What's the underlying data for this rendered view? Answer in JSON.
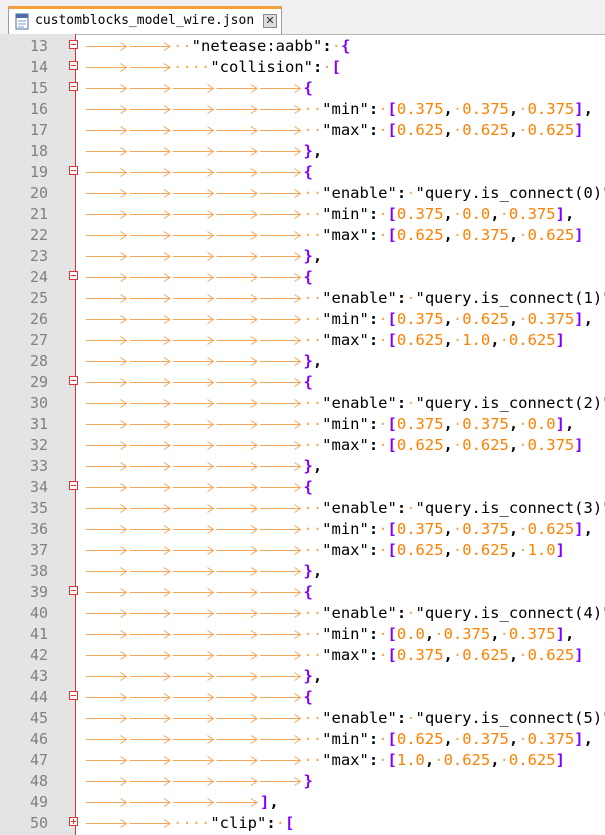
{
  "tab": {
    "title": "customblocks_model_wire.json"
  },
  "lines": [
    {
      "n": "13",
      "tabs": 2,
      "dots": 2,
      "fold": "minus",
      "tokens": [
        [
          "s",
          "\"netease:aabb\""
        ],
        [
          "o",
          ":"
        ],
        [
          "d",
          "·"
        ],
        [
          "p",
          "{"
        ]
      ]
    },
    {
      "n": "14",
      "tabs": 2,
      "dots": 4,
      "fold": "minus",
      "tokens": [
        [
          "s",
          "\"collision\""
        ],
        [
          "o",
          ":"
        ],
        [
          "d",
          "·"
        ],
        [
          "p",
          "["
        ]
      ]
    },
    {
      "n": "15",
      "tabs": 5,
      "dots": 0,
      "fold": "minus",
      "tokens": [
        [
          "p",
          "{"
        ]
      ]
    },
    {
      "n": "16",
      "tabs": 5,
      "dots": 2,
      "fold": "",
      "tokens": [
        [
          "s",
          "\"min\""
        ],
        [
          "o",
          ":"
        ],
        [
          "d",
          "·"
        ],
        [
          "p",
          "["
        ],
        [
          "n",
          "0.375"
        ],
        [
          "o",
          ","
        ],
        [
          "d",
          "·"
        ],
        [
          "n",
          "0.375"
        ],
        [
          "o",
          ","
        ],
        [
          "d",
          "·"
        ],
        [
          "n",
          "0.375"
        ],
        [
          "p",
          "]"
        ],
        [
          "o",
          ","
        ]
      ]
    },
    {
      "n": "17",
      "tabs": 5,
      "dots": 2,
      "fold": "",
      "tokens": [
        [
          "s",
          "\"max\""
        ],
        [
          "o",
          ":"
        ],
        [
          "d",
          "·"
        ],
        [
          "p",
          "["
        ],
        [
          "n",
          "0.625"
        ],
        [
          "o",
          ","
        ],
        [
          "d",
          "·"
        ],
        [
          "n",
          "0.625"
        ],
        [
          "o",
          ","
        ],
        [
          "d",
          "·"
        ],
        [
          "n",
          "0.625"
        ],
        [
          "p",
          "]"
        ]
      ]
    },
    {
      "n": "18",
      "tabs": 5,
      "dots": 0,
      "fold": "",
      "tokens": [
        [
          "p",
          "}"
        ],
        [
          "o",
          ","
        ]
      ]
    },
    {
      "n": "19",
      "tabs": 5,
      "dots": 0,
      "fold": "minus",
      "tokens": [
        [
          "p",
          "{"
        ]
      ]
    },
    {
      "n": "20",
      "tabs": 5,
      "dots": 2,
      "fold": "",
      "tokens": [
        [
          "s",
          "\"enable\""
        ],
        [
          "o",
          ":"
        ],
        [
          "d",
          "·"
        ],
        [
          "s",
          "\"query.is_connect(0)\""
        ],
        [
          "o",
          ","
        ]
      ]
    },
    {
      "n": "21",
      "tabs": 5,
      "dots": 2,
      "fold": "",
      "tokens": [
        [
          "s",
          "\"min\""
        ],
        [
          "o",
          ":"
        ],
        [
          "d",
          "·"
        ],
        [
          "p",
          "["
        ],
        [
          "n",
          "0.375"
        ],
        [
          "o",
          ","
        ],
        [
          "d",
          "·"
        ],
        [
          "n",
          "0.0"
        ],
        [
          "o",
          ","
        ],
        [
          "d",
          "·"
        ],
        [
          "n",
          "0.375"
        ],
        [
          "p",
          "]"
        ],
        [
          "o",
          ","
        ]
      ]
    },
    {
      "n": "22",
      "tabs": 5,
      "dots": 2,
      "fold": "",
      "tokens": [
        [
          "s",
          "\"max\""
        ],
        [
          "o",
          ":"
        ],
        [
          "d",
          "·"
        ],
        [
          "p",
          "["
        ],
        [
          "n",
          "0.625"
        ],
        [
          "o",
          ","
        ],
        [
          "d",
          "·"
        ],
        [
          "n",
          "0.375"
        ],
        [
          "o",
          ","
        ],
        [
          "d",
          "·"
        ],
        [
          "n",
          "0.625"
        ],
        [
          "p",
          "]"
        ]
      ]
    },
    {
      "n": "23",
      "tabs": 5,
      "dots": 0,
      "fold": "",
      "tokens": [
        [
          "p",
          "}"
        ],
        [
          "o",
          ","
        ]
      ]
    },
    {
      "n": "24",
      "tabs": 5,
      "dots": 0,
      "fold": "minus",
      "tokens": [
        [
          "p",
          "{"
        ]
      ]
    },
    {
      "n": "25",
      "tabs": 5,
      "dots": 2,
      "fold": "",
      "tokens": [
        [
          "s",
          "\"enable\""
        ],
        [
          "o",
          ":"
        ],
        [
          "d",
          "·"
        ],
        [
          "s",
          "\"query.is_connect(1)\""
        ],
        [
          "o",
          ","
        ]
      ]
    },
    {
      "n": "26",
      "tabs": 5,
      "dots": 2,
      "fold": "",
      "tokens": [
        [
          "s",
          "\"min\""
        ],
        [
          "o",
          ":"
        ],
        [
          "d",
          "·"
        ],
        [
          "p",
          "["
        ],
        [
          "n",
          "0.375"
        ],
        [
          "o",
          ","
        ],
        [
          "d",
          "·"
        ],
        [
          "n",
          "0.625"
        ],
        [
          "o",
          ","
        ],
        [
          "d",
          "·"
        ],
        [
          "n",
          "0.375"
        ],
        [
          "p",
          "]"
        ],
        [
          "o",
          ","
        ]
      ]
    },
    {
      "n": "27",
      "tabs": 5,
      "dots": 2,
      "fold": "",
      "tokens": [
        [
          "s",
          "\"max\""
        ],
        [
          "o",
          ":"
        ],
        [
          "d",
          "·"
        ],
        [
          "p",
          "["
        ],
        [
          "n",
          "0.625"
        ],
        [
          "o",
          ","
        ],
        [
          "d",
          "·"
        ],
        [
          "n",
          "1.0"
        ],
        [
          "o",
          ","
        ],
        [
          "d",
          "·"
        ],
        [
          "n",
          "0.625"
        ],
        [
          "p",
          "]"
        ]
      ]
    },
    {
      "n": "28",
      "tabs": 5,
      "dots": 0,
      "fold": "",
      "tokens": [
        [
          "p",
          "}"
        ],
        [
          "o",
          ","
        ]
      ]
    },
    {
      "n": "29",
      "tabs": 5,
      "dots": 0,
      "fold": "minus",
      "tokens": [
        [
          "p",
          "{"
        ]
      ]
    },
    {
      "n": "30",
      "tabs": 5,
      "dots": 2,
      "fold": "",
      "tokens": [
        [
          "s",
          "\"enable\""
        ],
        [
          "o",
          ":"
        ],
        [
          "d",
          "·"
        ],
        [
          "s",
          "\"query.is_connect(2)\""
        ],
        [
          "o",
          ","
        ]
      ]
    },
    {
      "n": "31",
      "tabs": 5,
      "dots": 2,
      "fold": "",
      "tokens": [
        [
          "s",
          "\"min\""
        ],
        [
          "o",
          ":"
        ],
        [
          "d",
          "·"
        ],
        [
          "p",
          "["
        ],
        [
          "n",
          "0.375"
        ],
        [
          "o",
          ","
        ],
        [
          "d",
          "·"
        ],
        [
          "n",
          "0.375"
        ],
        [
          "o",
          ","
        ],
        [
          "d",
          "·"
        ],
        [
          "n",
          "0.0"
        ],
        [
          "p",
          "]"
        ],
        [
          "o",
          ","
        ]
      ]
    },
    {
      "n": "32",
      "tabs": 5,
      "dots": 2,
      "fold": "",
      "tokens": [
        [
          "s",
          "\"max\""
        ],
        [
          "o",
          ":"
        ],
        [
          "d",
          "·"
        ],
        [
          "p",
          "["
        ],
        [
          "n",
          "0.625"
        ],
        [
          "o",
          ","
        ],
        [
          "d",
          "·"
        ],
        [
          "n",
          "0.625"
        ],
        [
          "o",
          ","
        ],
        [
          "d",
          "·"
        ],
        [
          "n",
          "0.375"
        ],
        [
          "p",
          "]"
        ]
      ]
    },
    {
      "n": "33",
      "tabs": 5,
      "dots": 0,
      "fold": "",
      "tokens": [
        [
          "p",
          "}"
        ],
        [
          "o",
          ","
        ]
      ]
    },
    {
      "n": "34",
      "tabs": 5,
      "dots": 0,
      "fold": "minus",
      "tokens": [
        [
          "p",
          "{"
        ]
      ]
    },
    {
      "n": "35",
      "tabs": 5,
      "dots": 2,
      "fold": "",
      "tokens": [
        [
          "s",
          "\"enable\""
        ],
        [
          "o",
          ":"
        ],
        [
          "d",
          "·"
        ],
        [
          "s",
          "\"query.is_connect(3)\""
        ],
        [
          "o",
          ","
        ]
      ]
    },
    {
      "n": "36",
      "tabs": 5,
      "dots": 2,
      "fold": "",
      "tokens": [
        [
          "s",
          "\"min\""
        ],
        [
          "o",
          ":"
        ],
        [
          "d",
          "·"
        ],
        [
          "p",
          "["
        ],
        [
          "n",
          "0.375"
        ],
        [
          "o",
          ","
        ],
        [
          "d",
          "·"
        ],
        [
          "n",
          "0.375"
        ],
        [
          "o",
          ","
        ],
        [
          "d",
          "·"
        ],
        [
          "n",
          "0.625"
        ],
        [
          "p",
          "]"
        ],
        [
          "o",
          ","
        ]
      ]
    },
    {
      "n": "37",
      "tabs": 5,
      "dots": 2,
      "fold": "",
      "tokens": [
        [
          "s",
          "\"max\""
        ],
        [
          "o",
          ":"
        ],
        [
          "d",
          "·"
        ],
        [
          "p",
          "["
        ],
        [
          "n",
          "0.625"
        ],
        [
          "o",
          ","
        ],
        [
          "d",
          "·"
        ],
        [
          "n",
          "0.625"
        ],
        [
          "o",
          ","
        ],
        [
          "d",
          "·"
        ],
        [
          "n",
          "1.0"
        ],
        [
          "p",
          "]"
        ]
      ]
    },
    {
      "n": "38",
      "tabs": 5,
      "dots": 0,
      "fold": "",
      "tokens": [
        [
          "p",
          "}"
        ],
        [
          "o",
          ","
        ]
      ]
    },
    {
      "n": "39",
      "tabs": 5,
      "dots": 0,
      "fold": "minus",
      "tokens": [
        [
          "p",
          "{"
        ]
      ]
    },
    {
      "n": "40",
      "tabs": 5,
      "dots": 2,
      "fold": "",
      "tokens": [
        [
          "s",
          "\"enable\""
        ],
        [
          "o",
          ":"
        ],
        [
          "d",
          "·"
        ],
        [
          "s",
          "\"query.is_connect(4)\""
        ],
        [
          "o",
          ","
        ]
      ]
    },
    {
      "n": "41",
      "tabs": 5,
      "dots": 2,
      "fold": "",
      "tokens": [
        [
          "s",
          "\"min\""
        ],
        [
          "o",
          ":"
        ],
        [
          "d",
          "·"
        ],
        [
          "p",
          "["
        ],
        [
          "n",
          "0.0"
        ],
        [
          "o",
          ","
        ],
        [
          "d",
          "·"
        ],
        [
          "n",
          "0.375"
        ],
        [
          "o",
          ","
        ],
        [
          "d",
          "·"
        ],
        [
          "n",
          "0.375"
        ],
        [
          "p",
          "]"
        ],
        [
          "o",
          ","
        ]
      ]
    },
    {
      "n": "42",
      "tabs": 5,
      "dots": 2,
      "fold": "",
      "tokens": [
        [
          "s",
          "\"max\""
        ],
        [
          "o",
          ":"
        ],
        [
          "d",
          "·"
        ],
        [
          "p",
          "["
        ],
        [
          "n",
          "0.375"
        ],
        [
          "o",
          ","
        ],
        [
          "d",
          "·"
        ],
        [
          "n",
          "0.625"
        ],
        [
          "o",
          ","
        ],
        [
          "d",
          "·"
        ],
        [
          "n",
          "0.625"
        ],
        [
          "p",
          "]"
        ]
      ]
    },
    {
      "n": "43",
      "tabs": 5,
      "dots": 0,
      "fold": "",
      "tokens": [
        [
          "p",
          "}"
        ],
        [
          "o",
          ","
        ]
      ]
    },
    {
      "n": "44",
      "tabs": 5,
      "dots": 0,
      "fold": "minus",
      "tokens": [
        [
          "p",
          "{"
        ]
      ]
    },
    {
      "n": "45",
      "tabs": 5,
      "dots": 2,
      "fold": "",
      "tokens": [
        [
          "s",
          "\"enable\""
        ],
        [
          "o",
          ":"
        ],
        [
          "d",
          "·"
        ],
        [
          "s",
          "\"query.is_connect(5)\""
        ],
        [
          "o",
          ","
        ]
      ]
    },
    {
      "n": "46",
      "tabs": 5,
      "dots": 2,
      "fold": "",
      "tokens": [
        [
          "s",
          "\"min\""
        ],
        [
          "o",
          ":"
        ],
        [
          "d",
          "·"
        ],
        [
          "p",
          "["
        ],
        [
          "n",
          "0.625"
        ],
        [
          "o",
          ","
        ],
        [
          "d",
          "·"
        ],
        [
          "n",
          "0.375"
        ],
        [
          "o",
          ","
        ],
        [
          "d",
          "·"
        ],
        [
          "n",
          "0.375"
        ],
        [
          "p",
          "]"
        ],
        [
          "o",
          ","
        ]
      ]
    },
    {
      "n": "47",
      "tabs": 5,
      "dots": 2,
      "fold": "",
      "tokens": [
        [
          "s",
          "\"max\""
        ],
        [
          "o",
          ":"
        ],
        [
          "d",
          "·"
        ],
        [
          "p",
          "["
        ],
        [
          "n",
          "1.0"
        ],
        [
          "o",
          ","
        ],
        [
          "d",
          "·"
        ],
        [
          "n",
          "0.625"
        ],
        [
          "o",
          ","
        ],
        [
          "d",
          "·"
        ],
        [
          "n",
          "0.625"
        ],
        [
          "p",
          "]"
        ]
      ]
    },
    {
      "n": "48",
      "tabs": 5,
      "dots": 0,
      "fold": "",
      "tokens": [
        [
          "p",
          "}"
        ]
      ]
    },
    {
      "n": "49",
      "tabs": 4,
      "dots": 0,
      "fold": "",
      "tokens": [
        [
          "p",
          "]"
        ],
        [
          "o",
          ","
        ]
      ]
    },
    {
      "n": "50",
      "tabs": 2,
      "dots": 4,
      "fold": "plus",
      "tokens": [
        [
          "s",
          "\"clip\""
        ],
        [
          "o",
          ":"
        ],
        [
          "d",
          "·"
        ],
        [
          "p",
          "["
        ]
      ]
    }
  ],
  "colors": {
    "arrow": "#f4a65a",
    "dot": "#f4a65a",
    "number": "#ff8000",
    "bracket": "#8000ff",
    "fold": "#dd3333"
  }
}
